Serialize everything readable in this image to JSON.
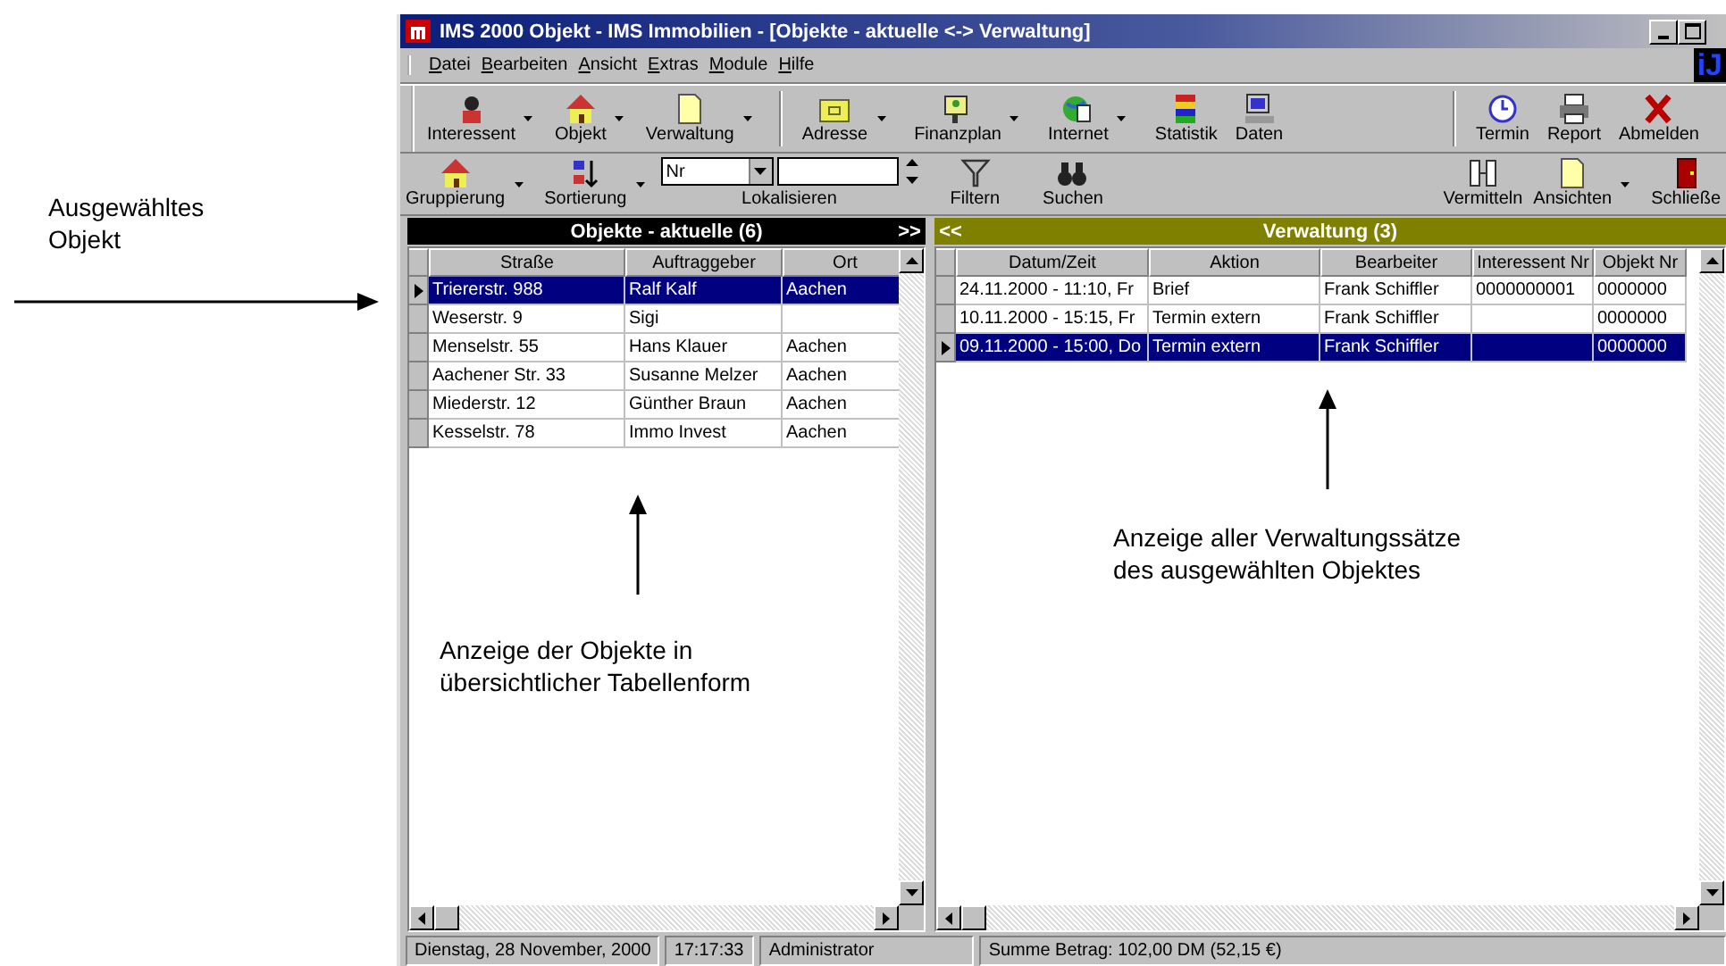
{
  "window": {
    "title": "IMS 2000 Objekt - IMS Immobilien - [Objekte - aktuelle <-> Verwaltung]",
    "logo": "iJ"
  },
  "menu": [
    "Datei",
    "Bearbeiten",
    "Ansicht",
    "Extras",
    "Module",
    "Hilfe"
  ],
  "toolbar": [
    {
      "label": "Interessent",
      "dropdown": true
    },
    {
      "label": "Objekt",
      "dropdown": true
    },
    {
      "label": "Verwaltung",
      "dropdown": true
    },
    {
      "label": "Adresse",
      "dropdown": true
    },
    {
      "label": "Finanzplan",
      "dropdown": true
    },
    {
      "label": "Internet",
      "dropdown": true
    },
    {
      "label": "Statistik",
      "dropdown": false
    },
    {
      "label": "Daten",
      "dropdown": false
    },
    {
      "label": "Termin",
      "dropdown": false
    },
    {
      "label": "Report",
      "dropdown": false
    },
    {
      "label": "Abmelden",
      "dropdown": false
    }
  ],
  "toolbar2": {
    "left": [
      {
        "label": "Gruppierung",
        "dropdown": true
      },
      {
        "label": "Sortierung",
        "dropdown": true
      }
    ],
    "sort_field": {
      "value": "Nr"
    },
    "locate_label": "Lokalisieren",
    "middle": [
      {
        "label": "Filtern",
        "dropdown": false
      },
      {
        "label": "Suchen",
        "dropdown": false
      }
    ],
    "right": [
      {
        "label": "Vermitteln",
        "dropdown": false
      },
      {
        "label": "Ansichten",
        "dropdown": true
      },
      {
        "label": "Schließe",
        "dropdown": false
      }
    ]
  },
  "objects_panel": {
    "title": "Objekte - aktuelle (6)",
    "nav": ">>",
    "columns": [
      "Straße",
      "Auftraggeber",
      "Ort"
    ],
    "rows": [
      {
        "cells": [
          "Triererstr. 988",
          "Ralf Kalf",
          "Aachen"
        ],
        "selected": true
      },
      {
        "cells": [
          "Weserstr. 9",
          "Sigi",
          ""
        ],
        "selected": false
      },
      {
        "cells": [
          "Menselstr. 55",
          "Hans Klauer",
          "Aachen"
        ],
        "selected": false
      },
      {
        "cells": [
          "Aachener Str. 33",
          "Susanne Melzer",
          "Aachen"
        ],
        "selected": false
      },
      {
        "cells": [
          "Miederstr. 12",
          "Günther Braun",
          "Aachen"
        ],
        "selected": false
      },
      {
        "cells": [
          "Kesselstr. 78",
          "Immo Invest",
          "Aachen"
        ],
        "selected": false
      }
    ]
  },
  "admin_panel": {
    "title": "Verwaltung (3)",
    "nav": "<<",
    "columns": [
      "Datum/Zeit",
      "Aktion",
      "Bearbeiter",
      "Interessent Nr",
      "Objekt Nr"
    ],
    "rows": [
      {
        "cells": [
          "24.11.2000 - 11:10, Fr",
          "Brief",
          "Frank Schiffler",
          "0000000001",
          "0000000"
        ],
        "selected": false
      },
      {
        "cells": [
          "10.11.2000 - 15:15, Fr",
          "Termin extern",
          "Frank Schiffler",
          "",
          "0000000"
        ],
        "selected": false
      },
      {
        "cells": [
          "09.11.2000 - 15:00, Do",
          "Termin extern",
          "Frank Schiffler",
          "",
          "0000000"
        ],
        "selected": true
      }
    ]
  },
  "status_bar": [
    "Dienstag, 28 November, 2000",
    "17:17:33",
    "Administrator",
    "Summe Betrag: 102,00 DM  (52,15 €)"
  ],
  "annotations": [
    {
      "text": "Ausgewähltes\nObjekt"
    },
    {
      "text": "Anzeige der Objekte in\nübersichtlicher Tabellenform"
    },
    {
      "text": "Anzeige aller Verwaltungssätze\ndes ausgewählten Objektes"
    }
  ]
}
